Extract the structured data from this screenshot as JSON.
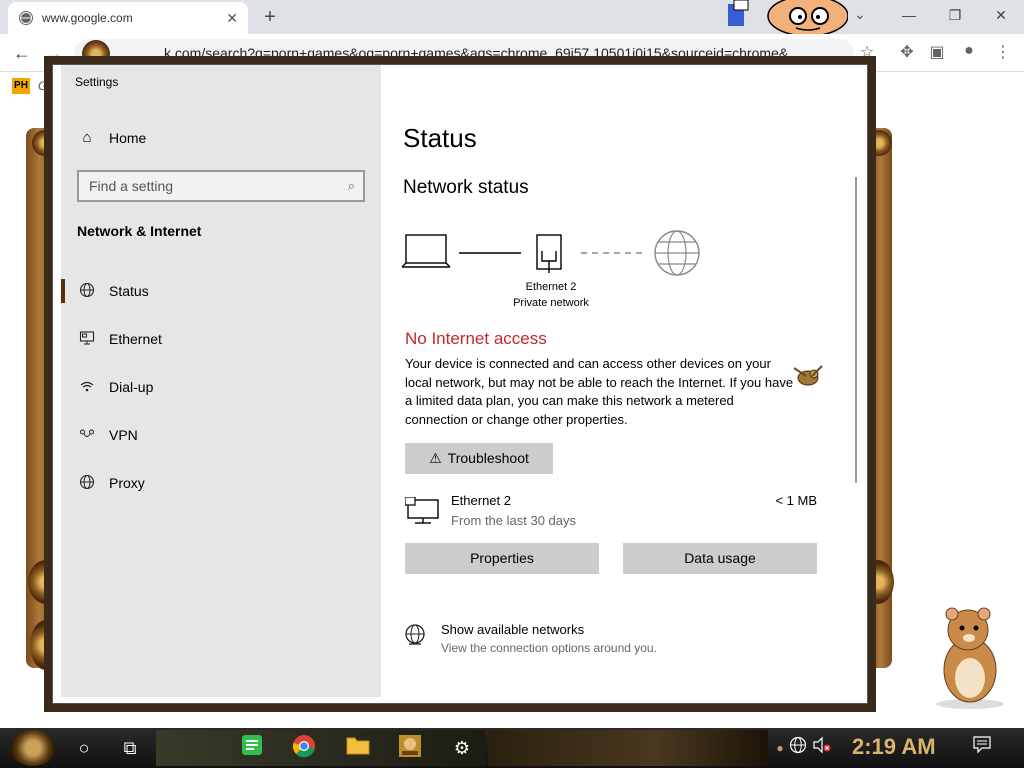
{
  "browser": {
    "tab_title": "www.google.com",
    "tab_close": "✕",
    "new_tab": "+",
    "dropdown": "⌄",
    "url_prefix": "",
    "url_tail": "k.com/search?q=porn+games&oq=porn+games&aqs=chrome..69i57.10501j0j15&sourceid=chrome&",
    "bookmark_icon_text": "PH",
    "bookmark_text": "Gi",
    "minimize": "—",
    "restore": "❐",
    "close": "✕"
  },
  "settings": {
    "window_title": "Settings",
    "minimize": "—",
    "maximize": "☐",
    "close": "✕",
    "sidebar": {
      "home_label": "Home",
      "search_placeholder": "Find a setting",
      "section_title": "Network & Internet",
      "items": [
        {
          "label": "Status",
          "icon": "globe-status-icon"
        },
        {
          "label": "Ethernet",
          "icon": "ethernet-icon"
        },
        {
          "label": "Dial-up",
          "icon": "dialup-icon"
        },
        {
          "label": "VPN",
          "icon": "vpn-icon"
        },
        {
          "label": "Proxy",
          "icon": "proxy-globe-icon"
        }
      ],
      "selected": "Status"
    },
    "main": {
      "page_title": "Status",
      "section_title": "Network status",
      "adapter_name": "Ethernet 2",
      "adapter_profile": "Private network",
      "status_heading": "No Internet access",
      "status_description": "Your device is connected and can access other devices on your local network, but may not be able to reach the Internet. If you have a limited data plan, you can make this network a metered connection or change other properties.",
      "troubleshoot_label": "Troubleshoot",
      "connection_name": "Ethernet 2",
      "connection_period": "From the last 30 days",
      "connection_usage": "< 1 MB",
      "properties_label": "Properties",
      "data_usage_label": "Data usage",
      "show_networks_title": "Show available networks",
      "show_networks_sub": "View the connection options around you."
    },
    "colors": {
      "error_red": "#c5262c",
      "sidebar_bg": "#e6e6e6",
      "button_bg": "#cccccc"
    }
  },
  "taskbar": {
    "clock": "2:19 AM",
    "icons": [
      "cortana-circle-icon",
      "task-view-icon",
      "notes-app-icon",
      "chrome-icon",
      "file-explorer-icon",
      "game-app-icon",
      "settings-gear-icon"
    ],
    "tray": [
      "network-globe-icon",
      "volume-muted-icon",
      "notification-icon"
    ]
  }
}
